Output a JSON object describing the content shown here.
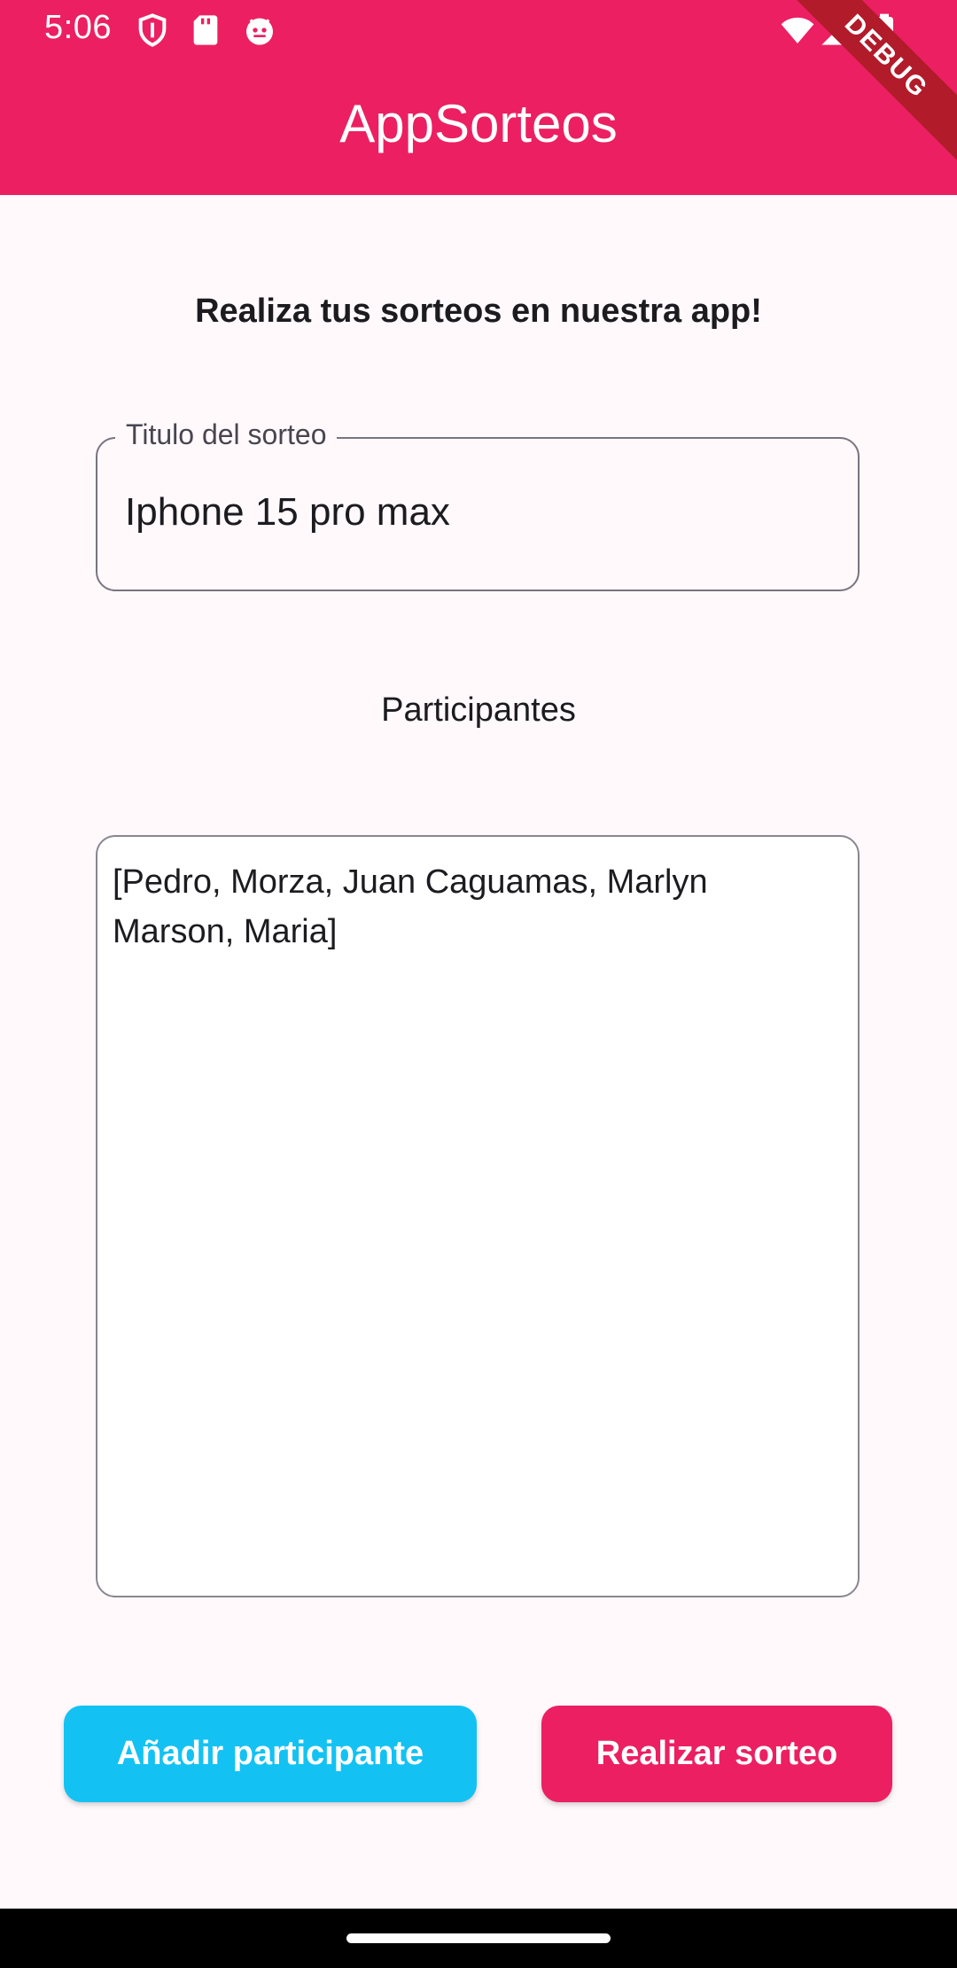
{
  "status_bar": {
    "time": "5:06",
    "left_icons": [
      "shield-icon",
      "sd-card-icon",
      "android-robot-icon"
    ],
    "right_icons": [
      "wifi-icon",
      "signal-icon",
      "battery-icon"
    ]
  },
  "app_bar": {
    "title": "AppSorteos",
    "debug_banner": "DEBUG",
    "color": "#EC1F63"
  },
  "main": {
    "headline": "Realiza tus sorteos en nuestra app!",
    "title_field": {
      "label": "Titulo del sorteo",
      "value": "Iphone 15 pro max"
    },
    "participants_label": "Participantes",
    "participants_list": "[Pedro, Morza, Juan Caguamas, Marlyn Marson, Maria]"
  },
  "buttons": {
    "add_participant": {
      "label": "Añadir participante",
      "color": "#13C2F2"
    },
    "draw": {
      "label": "Realizar sorteo",
      "color": "#EC1F63"
    }
  }
}
